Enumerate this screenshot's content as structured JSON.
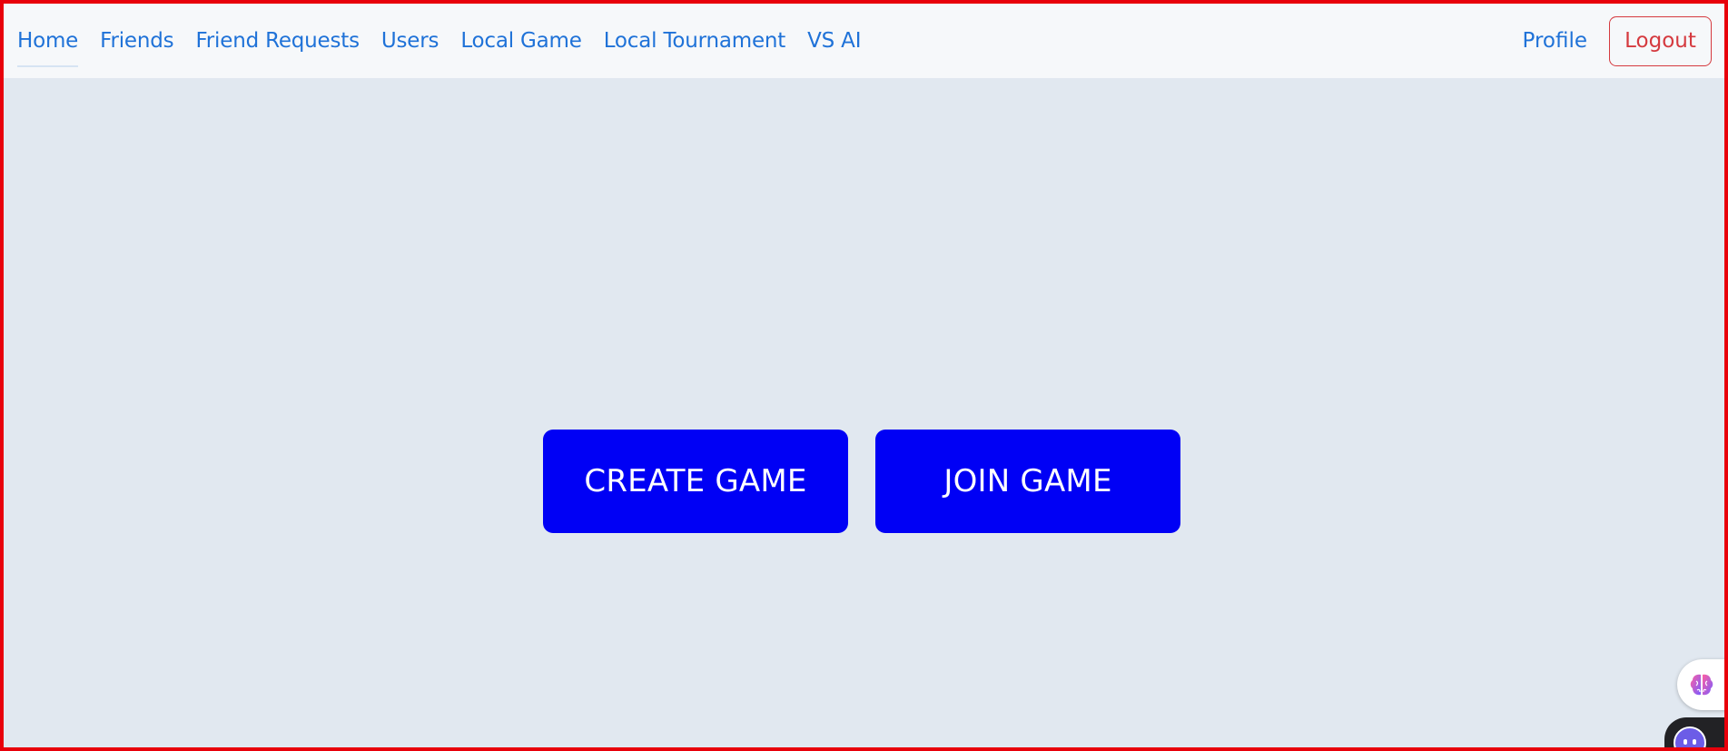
{
  "nav": {
    "items": [
      {
        "label": "Home"
      },
      {
        "label": "Friends"
      },
      {
        "label": "Friend Requests"
      },
      {
        "label": "Users"
      },
      {
        "label": "Local Game"
      },
      {
        "label": "Local Tournament"
      },
      {
        "label": "VS AI"
      }
    ],
    "active": "Home",
    "profile_label": "Profile",
    "logout_label": "Logout"
  },
  "main": {
    "create_game_label": "CREATE GAME",
    "join_game_label": "JOIN GAME"
  },
  "widgets": {
    "brain_icon": "brain-icon",
    "assistant_icon": "assistant-face-icon"
  },
  "colors": {
    "nav_link": "#1f72d8",
    "logout": "#d53a3f",
    "game_button": "#0000f5",
    "background": "#e1e8f0",
    "frame_border": "#e8000b"
  }
}
